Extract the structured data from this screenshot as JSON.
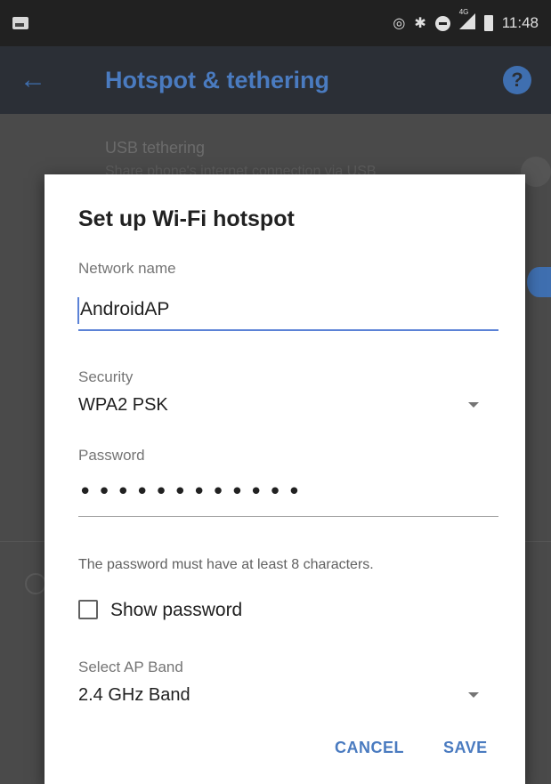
{
  "status_bar": {
    "time": "11:48",
    "icons": [
      "image-icon",
      "hotspot-icon",
      "bluetooth-icon",
      "do-not-disturb-icon",
      "signal-4g-icon",
      "battery-icon"
    ],
    "network_badge": "4G"
  },
  "app_bar": {
    "title": "Hotspot & tethering",
    "back_icon": "arrow-left-icon",
    "help_icon": "help-icon",
    "help_glyph": "?"
  },
  "background": {
    "usb_title": "USB tethering",
    "usb_subtitle": "Share phone's internet connection via USB"
  },
  "dialog": {
    "title": "Set up Wi-Fi hotspot",
    "network_name": {
      "label": "Network name",
      "value": "AndroidAP"
    },
    "security": {
      "label": "Security",
      "value": "WPA2 PSK"
    },
    "password": {
      "label": "Password",
      "value": "••••••••••••",
      "hint": "The password must have at least 8 characters."
    },
    "show_password": {
      "label": "Show password",
      "checked": false
    },
    "ap_band": {
      "label": "Select AP Band",
      "value": "2.4 GHz Band"
    },
    "buttons": {
      "cancel": "CANCEL",
      "save": "SAVE"
    }
  },
  "colors": {
    "accent": "#4a7bc0",
    "input_active": "#5b82d6",
    "dialog_bg": "#ffffff",
    "scrim": "#3a3a3a"
  }
}
